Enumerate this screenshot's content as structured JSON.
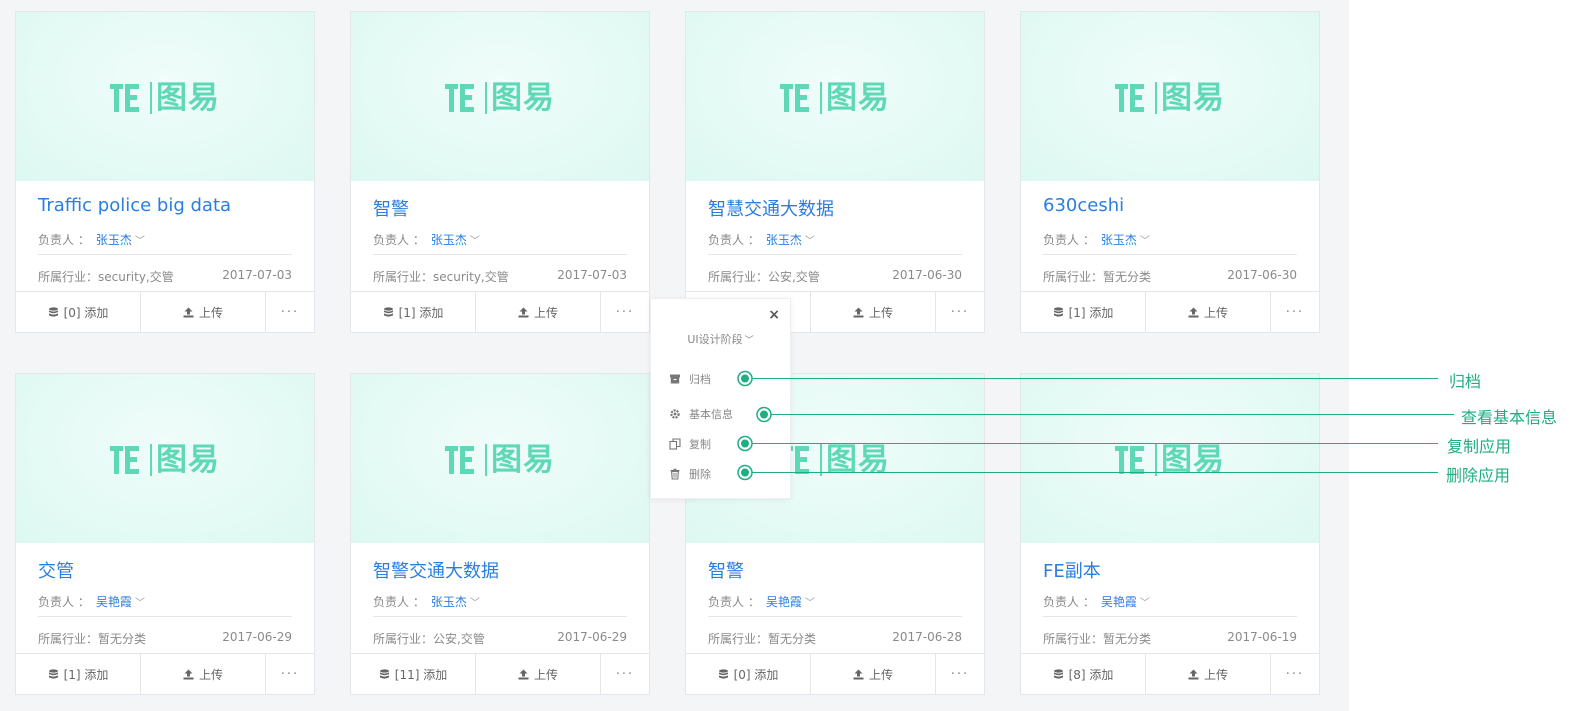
{
  "logo_text": "图易",
  "owner_label": "负责人 ：",
  "industry_prefix": "所属行业：",
  "upload_label": "上传",
  "more_label": "···",
  "colors": {
    "title_blue": "#2a7ee0",
    "logo_teal": "#5fd8b8",
    "annotation_green": "#1fae82",
    "board_bg": "#f4f5f7"
  },
  "cards": [
    {
      "title": "Traffic police big data",
      "owner": "张玉杰",
      "industry": "security,交管",
      "date": "2017-07-03",
      "add": "[0] 添加"
    },
    {
      "title": "智警",
      "owner": "张玉杰",
      "industry": "security,交管",
      "date": "2017-07-03",
      "add": "[1] 添加"
    },
    {
      "title": "智慧交通大数据",
      "owner": "张玉杰",
      "industry": "公安,交管",
      "date": "2017-06-30",
      "add": ""
    },
    {
      "title": "630ceshi",
      "owner": "张玉杰",
      "industry": "暂无分类",
      "date": "2017-06-30",
      "add": "[1] 添加"
    },
    {
      "title": "交管",
      "owner": "吴艳霞",
      "industry": "暂无分类",
      "date": "2017-06-29",
      "add": "[1] 添加"
    },
    {
      "title": "智警交通大数据",
      "owner": "张玉杰",
      "industry": "公安,交管",
      "date": "2017-06-29",
      "add": "[11] 添加"
    },
    {
      "title": "智警",
      "owner": "吴艳霞",
      "industry": "暂无分类",
      "date": "2017-06-28",
      "add": "[0] 添加"
    },
    {
      "title": "FE副本",
      "owner": "吴艳霞",
      "industry": "暂无分类",
      "date": "2017-06-19",
      "add": "[8] 添加"
    }
  ],
  "popup": {
    "close": "×",
    "stage": "UI设计阶段",
    "items": [
      {
        "label": "归档",
        "icon": "archive-icon"
      },
      {
        "label": "基本信息",
        "icon": "gear-icon"
      },
      {
        "label": "复制",
        "icon": "copy-icon"
      },
      {
        "label": "删除",
        "icon": "trash-icon"
      }
    ]
  },
  "annotations": [
    {
      "text": "归档"
    },
    {
      "text": "查看基本信息"
    },
    {
      "text": "复制应用"
    },
    {
      "text": "删除应用"
    }
  ]
}
